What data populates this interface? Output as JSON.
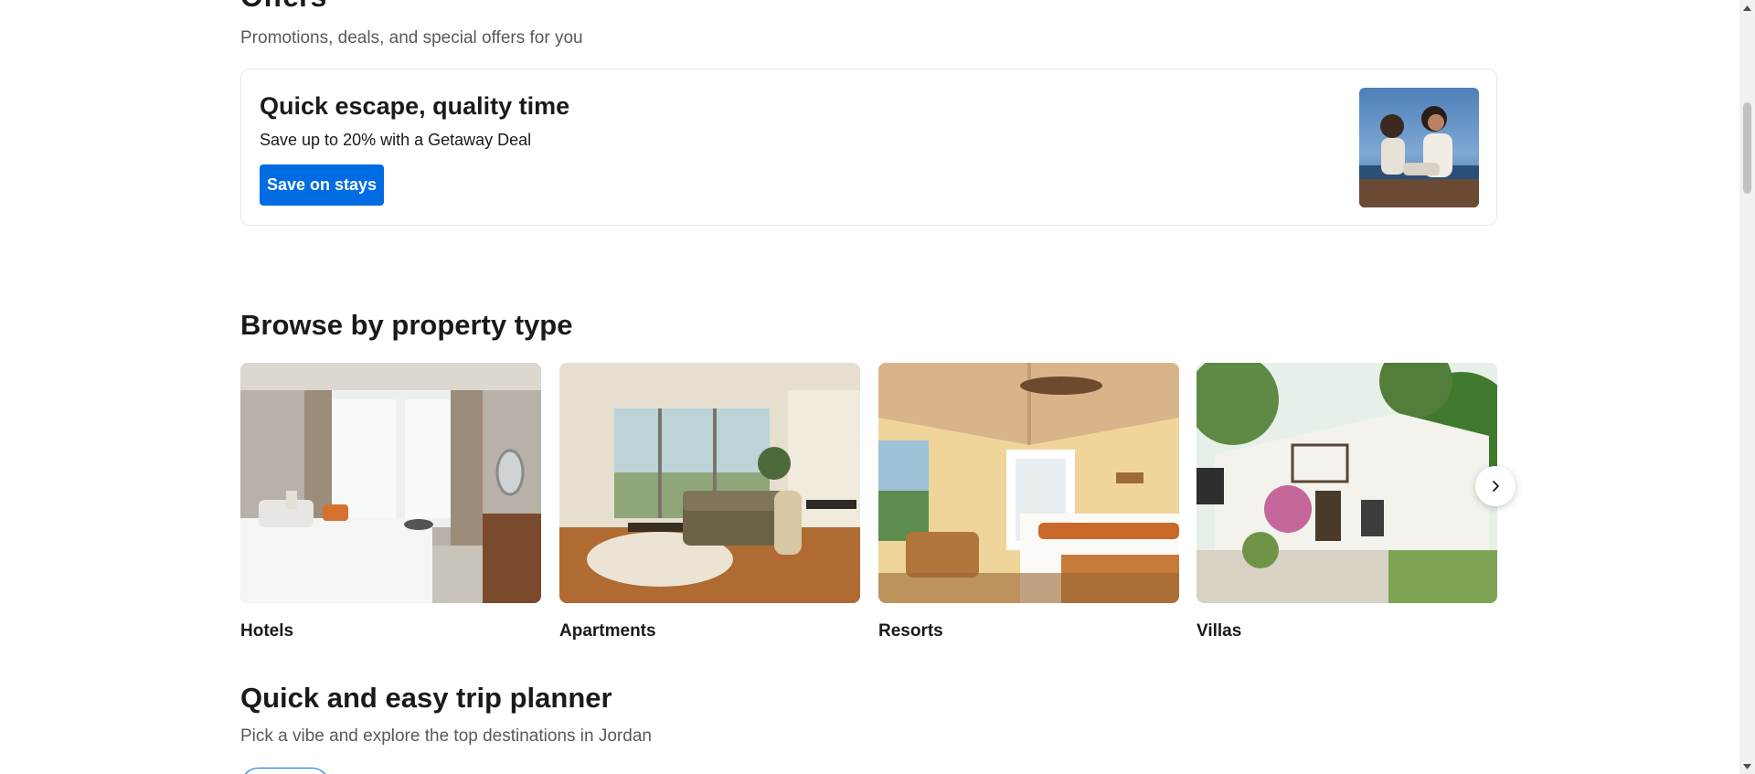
{
  "offers": {
    "title": "Offers",
    "subtitle": "Promotions, deals, and special offers for you",
    "card": {
      "heading": "Quick escape, quality time",
      "text": "Save up to 20% with a Getaway Deal",
      "button_label": "Save on stays"
    }
  },
  "browse": {
    "title": "Browse by property type",
    "items": [
      {
        "label": "Hotels"
      },
      {
        "label": "Apartments"
      },
      {
        "label": "Resorts"
      },
      {
        "label": "Villas"
      }
    ]
  },
  "planner": {
    "title": "Quick and easy trip planner",
    "subtitle": "Pick a vibe and explore the top destinations in Jordan"
  },
  "colors": {
    "brand_blue": "#006ce4",
    "text_primary": "#1a1a1a",
    "text_secondary": "#595959"
  },
  "icons": {
    "carousel_next": "chevron-right-icon",
    "scroll_up": "arrow-up-icon",
    "scroll_down": "arrow-down-icon"
  }
}
